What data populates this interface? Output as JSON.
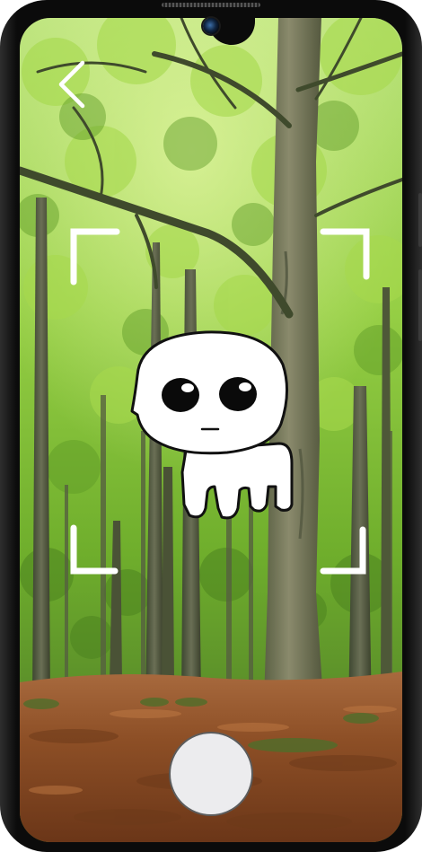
{
  "camera_view": {
    "mode": "ar-capture",
    "back_icon": "chevron-left-icon",
    "capture_button": "shutter-button",
    "focus_frame": "corner-brackets",
    "ar_character": "white-creature-sticker"
  },
  "colors": {
    "overlay": "#ffffff",
    "shutter_fill": "#ececee",
    "shutter_border": "#5c5c5c",
    "phone_body": "#0b0b0b",
    "foliage": "#8fcc3a",
    "ground": "#8a4a22"
  }
}
